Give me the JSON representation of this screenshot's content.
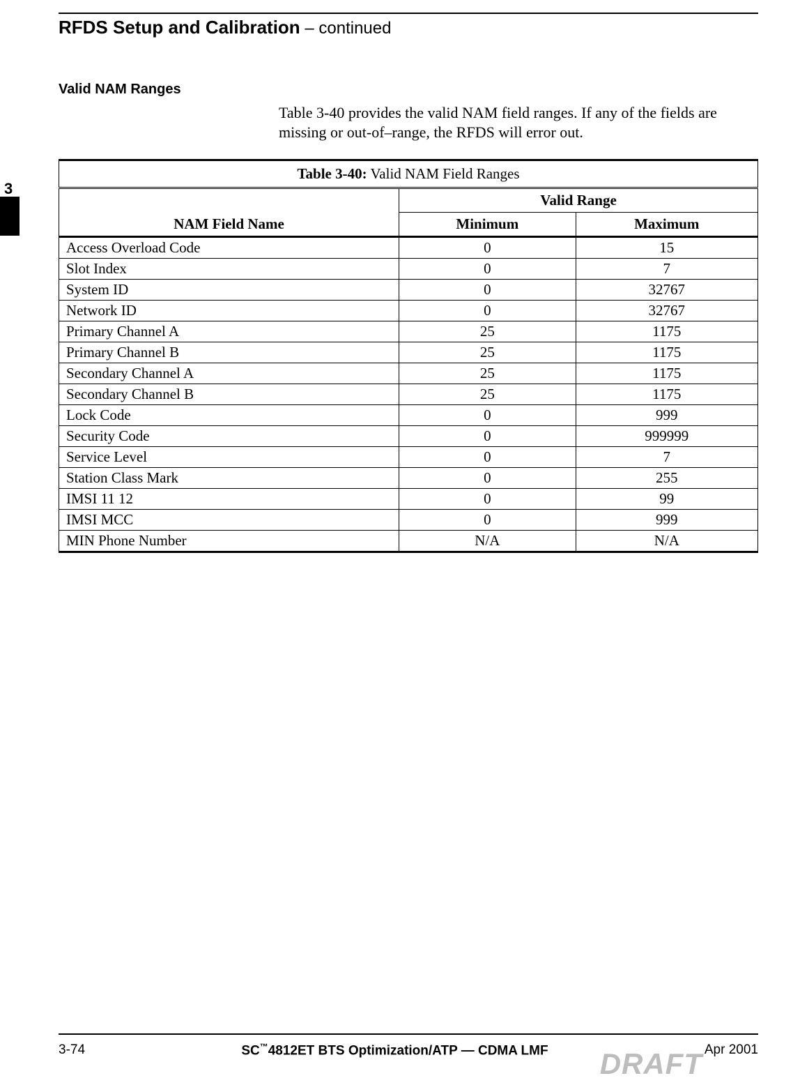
{
  "header": {
    "title_bold": "RFDS Setup and Calibration",
    "title_cont": " – continued"
  },
  "subheading": "Valid NAM Ranges",
  "intro": "Table 3-40 provides the valid NAM field ranges. If any of the fields are missing or out-of–range, the RFDS will error out.",
  "tab_number": "3",
  "table": {
    "caption_bold": "Table 3-40:",
    "caption_rest": " Valid NAM Field Ranges",
    "col_field": "NAM Field Name",
    "col_range": "Valid Range",
    "col_min": "Minimum",
    "col_max": "Maximum",
    "rows": [
      {
        "name": "Access Overload Code",
        "min": "0",
        "max": "15"
      },
      {
        "name": "Slot Index",
        "min": "0",
        "max": "7"
      },
      {
        "name": "System ID",
        "min": "0",
        "max": "32767"
      },
      {
        "name": "Network ID",
        "min": "0",
        "max": "32767"
      },
      {
        "name": "Primary Channel A",
        "min": "25",
        "max": "1175"
      },
      {
        "name": "Primary Channel B",
        "min": "25",
        "max": "1175"
      },
      {
        "name": "Secondary Channel A",
        "min": "25",
        "max": "1175"
      },
      {
        "name": "Secondary Channel B",
        "min": "25",
        "max": "1175"
      },
      {
        "name": "Lock Code",
        "min": "0",
        "max": "999"
      },
      {
        "name": "Security Code",
        "min": "0",
        "max": "999999"
      },
      {
        "name": "Service Level",
        "min": "0",
        "max": "7"
      },
      {
        "name": "Station Class Mark",
        "min": "0",
        "max": "255"
      },
      {
        "name": "IMSI 11 12",
        "min": "0",
        "max": "99"
      },
      {
        "name": "IMSI MCC",
        "min": "0",
        "max": "999"
      },
      {
        "name": "MIN Phone Number",
        "min": "N/A",
        "max": "N/A"
      }
    ]
  },
  "footer": {
    "page": "3-74",
    "mid_prefix": "SC",
    "mid_tm": "™",
    "mid_rest": "4812ET BTS Optimization/ATP — CDMA LMF",
    "date": "Apr 2001",
    "watermark": "DRAFT"
  }
}
